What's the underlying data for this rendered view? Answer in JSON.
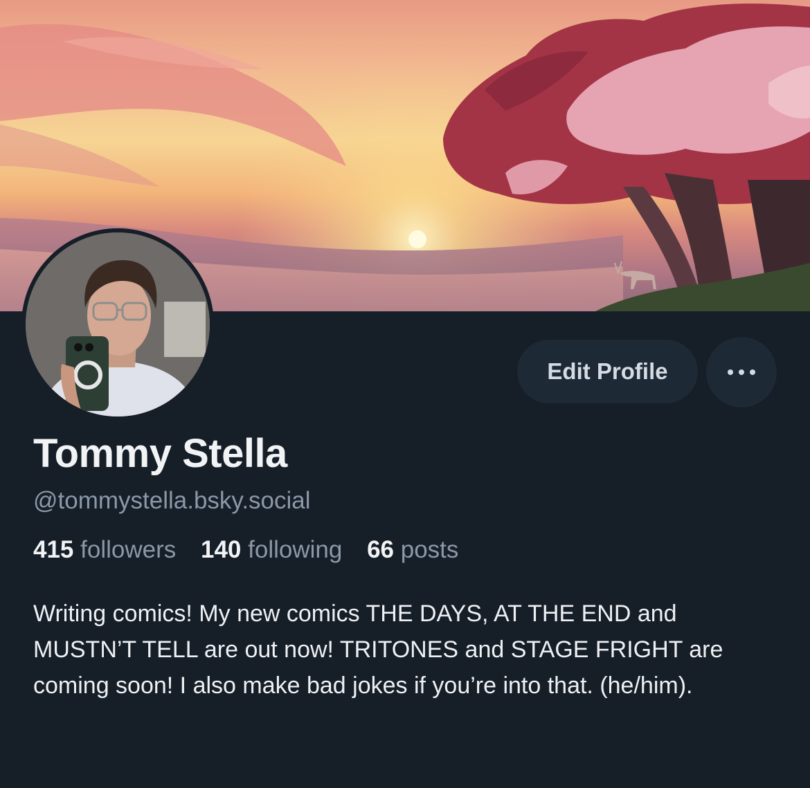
{
  "profile": {
    "display_name": "Tommy Stella",
    "handle": "@tommystella.bsky.social",
    "stats": {
      "followers_count": "415",
      "followers_label": "followers",
      "following_count": "140",
      "following_label": "following",
      "posts_count": "66",
      "posts_label": "posts"
    },
    "bio": "Writing comics! My new comics THE DAYS, AT THE END and MUSTN’T TELL are out now! TRITONES and STAGE FRIGHT are coming soon! I also make bad jokes if you’re into that. (he/him)."
  },
  "actions": {
    "edit_profile_label": "Edit Profile",
    "more_icon": "ellipsis-icon"
  },
  "colors": {
    "background": "#161e27",
    "button_bg": "#1e2936",
    "muted_text": "#8b98a8",
    "primary_text": "#f1f3f5"
  }
}
